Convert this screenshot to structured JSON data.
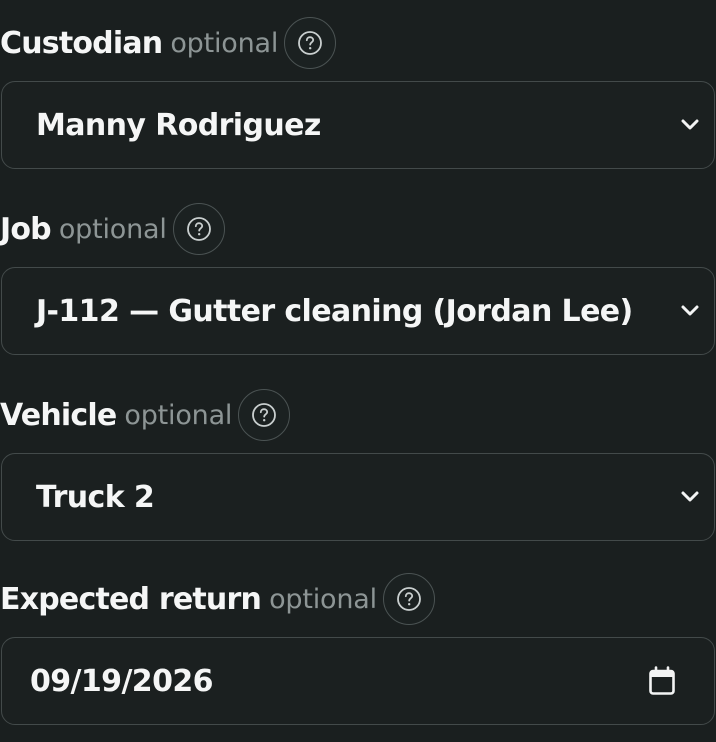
{
  "fields": [
    {
      "label": "Custodian",
      "optional_text": "optional",
      "help_icon": "question-circle-icon",
      "type": "select",
      "value": "Manny Rodriguez"
    },
    {
      "label": "Job",
      "optional_text": "optional",
      "help_icon": "question-circle-icon",
      "type": "select",
      "value": "J-112 — Gutter cleaning (Jordan Lee)"
    },
    {
      "label": "Vehicle",
      "optional_text": "optional",
      "help_icon": "question-circle-icon",
      "type": "select",
      "value": "Truck 2"
    },
    {
      "label": "Expected return",
      "optional_text": "optional",
      "help_icon": "question-circle-icon",
      "type": "date",
      "value": "09/19/2026",
      "trailing_icon": "calendar-icon"
    }
  ],
  "colors": {
    "background": "#1a1f1f",
    "text": "#f5f6f6",
    "muted": "#8d9595",
    "border": "#434a4a"
  }
}
